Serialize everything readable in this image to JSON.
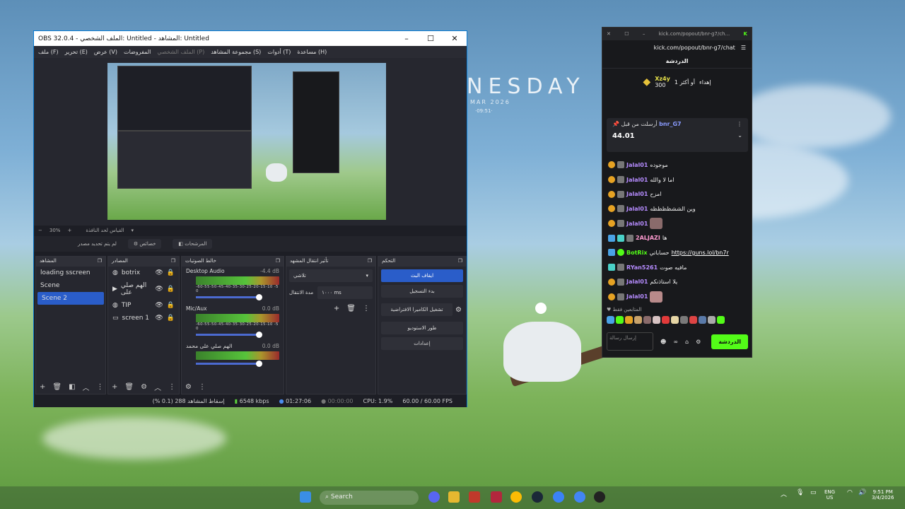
{
  "wallpaper": {
    "title": "NESDAY",
    "date": "MAR 2026",
    "time": "·09:51·"
  },
  "obs": {
    "title": "OBS 32.0.4 - الملف الشخصي: Untitled - المشاهد: Untitled",
    "menu": [
      "ملف (F)",
      "تحرير (E)",
      "عرض (V)",
      "المفروضات",
      "الملف الشخصي (P)",
      "مجموعة المشاهد (S)",
      "أدوات (T)",
      "مساعدة (H)"
    ],
    "zoom": "30%",
    "zoom_label": "القياس لحد النافذة",
    "source_none": "لم يتم تحديد مصدر",
    "properties": "خصائص",
    "filters": "المرشحات",
    "docks": {
      "scenes": "المشاهد",
      "sources": "المصادر",
      "mixer": "خالط الصوتيات",
      "transitions": "تأثير انتقال المشهد",
      "controls": "التحكم"
    },
    "scenes": [
      "loading sscreen",
      "Scene",
      "Scene 2"
    ],
    "sources": [
      "botrix",
      "الهم صلي على",
      "TIP",
      "screen 1"
    ],
    "mixer": [
      {
        "name": "Desktop Audio",
        "db": "-4.4 dB"
      },
      {
        "name": "Mic/Aux",
        "db": "0.0 dB"
      },
      {
        "name": "الهم صلي على محمد",
        "db": "0.0 dB"
      }
    ],
    "meter_scale": "-60-55-50-45-40-35-30-25-20-15-10 -5  0",
    "transition": {
      "type": "تلاشي",
      "duration_label": "مدة الانتقال",
      "duration": "١٠٠٠ ms"
    },
    "controls": [
      "ايقاف البث",
      "بدء التسجيل",
      "تشغيل الكاميرا الافتراضية",
      "طور الاستوديو",
      "إعدادات"
    ],
    "status": {
      "dropped": "إسقاط المشاهد 288 (0.1 %)",
      "kbps": "6548 kbps",
      "live": "01:27:06",
      "rec": "00:00:00",
      "cpu": "CPU: 1.9%",
      "fps": "60.00 / 60.00 FPS"
    }
  },
  "kick": {
    "tab_url": "kick.com/popout/bnr-g7/ch...",
    "url": "kick.com/popout/bnr-g7/chat",
    "header": "الدردشة",
    "gift": {
      "name": "Xz4y",
      "amount": "300",
      "label": "إهداء",
      "count": "1 أو أكثر"
    },
    "pinned": {
      "by": "أرسلت من قبل",
      "user": "bnr_G7",
      "message": "44.01"
    },
    "messages": [
      {
        "user": "Jalal01",
        "text": "موجوده",
        "color": "#b68cff"
      },
      {
        "user": "Jalal01",
        "text": "اما لا والله",
        "color": "#b68cff"
      },
      {
        "user": "Jalal01",
        "text": "امزح",
        "color": "#b68cff"
      },
      {
        "user": "Jalal01",
        "text": "وين الششظظظظه",
        "color": "#b68cff"
      },
      {
        "user": "Jalal01",
        "text": "",
        "color": "#b68cff"
      },
      {
        "user": "2ALJAZI",
        "text": "ها",
        "color": "#ff9bd1"
      },
      {
        "user": "BotRix",
        "text": "حساباتي",
        "link": "https://guns.lol/bn7r",
        "color": "#53fc18"
      },
      {
        "user": "RYan5261",
        "text": "مافيه صوت",
        "color": "#b68cff"
      },
      {
        "user": "Jalal01",
        "text": "يلا استاذنكم",
        "color": "#b68cff"
      },
      {
        "user": "Jalal01",
        "text": "",
        "color": "#b68cff"
      }
    ],
    "subs_only": "المتابعين فقط",
    "input_placeholder": "إرسال رسالة",
    "send": "الدردشة"
  },
  "taskbar": {
    "search": "Search",
    "lang": "ENG",
    "region": "US",
    "time": "9:51 PM",
    "date": "3/4/2026"
  },
  "colors": {
    "obs_accent": "#2a5dc9",
    "kick_green": "#53fc18"
  }
}
